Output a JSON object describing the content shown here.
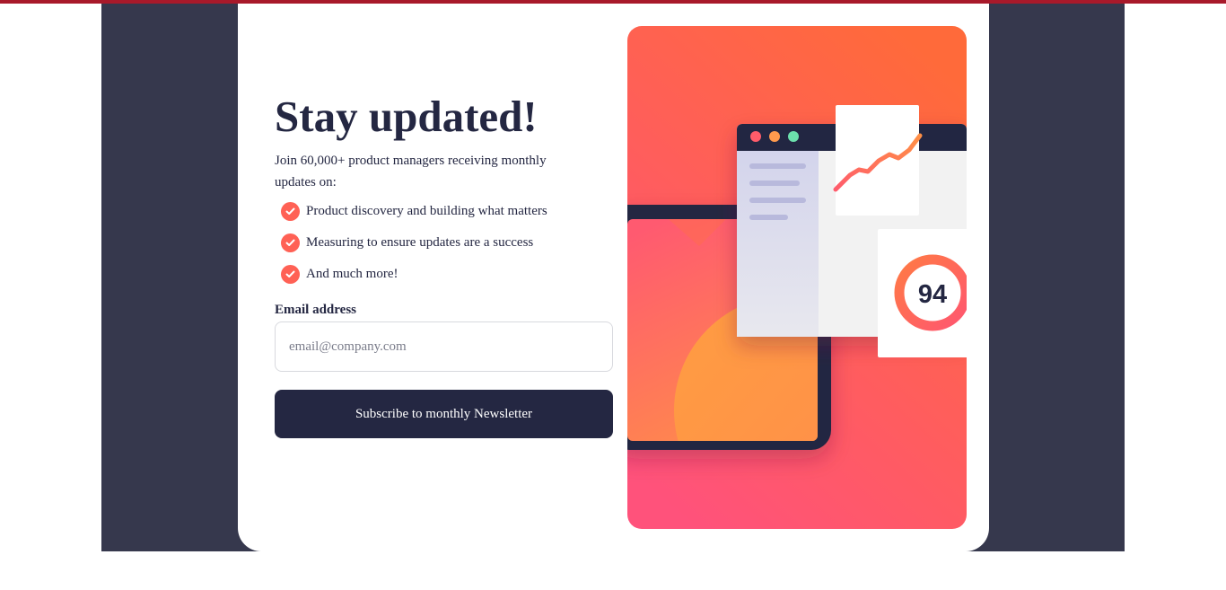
{
  "signup": {
    "title": "Stay updated!",
    "intro": "Join 60,000+ product managers receiving monthly updates on:",
    "features": [
      "Product discovery and building what matters",
      "Measuring to ensure updates are a success",
      "And much more!"
    ],
    "email": {
      "label": "Email address",
      "placeholder": "email@company.com",
      "value": ""
    },
    "submit_label": "Subscribe to monthly Newsletter"
  },
  "illustration": {
    "score": "94"
  },
  "colors": {
    "accent": "#ff6155",
    "dark_navy": "#242742",
    "charcoal": "#36384d",
    "top_bar": "#a8192a"
  },
  "icons": [
    "check-icon"
  ]
}
